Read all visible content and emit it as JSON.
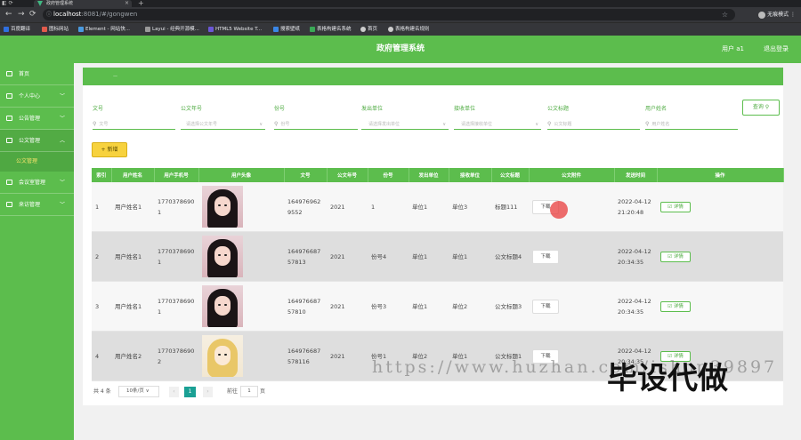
{
  "browser": {
    "tab_title": "政府管理系统",
    "url_host": "localhost",
    "url_path": ":8081/#/gongwen",
    "profile_label": "无痕模式",
    "bookmarks": [
      "百度翻译",
      "图标网站",
      "Element - 网站快...",
      "Layui - 经典开源模...",
      "HTML5 Website T...",
      "搜索壁纸",
      "表格构建名系统",
      "首页",
      "表格构建名规则"
    ]
  },
  "header": {
    "title": "政府管理系统",
    "user": "用户 a1",
    "logout": "退出登录"
  },
  "sidebar": {
    "items": [
      {
        "label": "首页",
        "has_children": false
      },
      {
        "label": "个人中心",
        "has_children": true
      },
      {
        "label": "公告管理",
        "has_children": true
      },
      {
        "label": "公文管理",
        "has_children": true,
        "open": true
      },
      {
        "label": "会议室管理",
        "has_children": true
      },
      {
        "label": "来访管理",
        "has_children": true
      }
    ],
    "submenu_label": "公文管理"
  },
  "breadcrumb": "—",
  "filters": {
    "wenhao": {
      "label": "文号",
      "placeholder": "文号"
    },
    "year": {
      "label": "公文年号",
      "placeholder": "请选择公文年号"
    },
    "fenhao": {
      "label": "份号",
      "placeholder": "份号"
    },
    "fawen": {
      "label": "发出单位",
      "placeholder": "请选择发出单位"
    },
    "jieshou": {
      "label": "接收单位",
      "placeholder": "请选择接收单位"
    },
    "biaoti": {
      "label": "公文标题",
      "placeholder": "公文标题"
    },
    "yonghu": {
      "label": "用户姓名",
      "placeholder": "用户姓名"
    },
    "query_label": "查询"
  },
  "add_label": "+ 新增",
  "table": {
    "headers": [
      "索引",
      "用户姓名",
      "用户手机号",
      "用户头像",
      "文号",
      "公文年号",
      "份号",
      "发出单位",
      "接收单位",
      "公文标题",
      "公文附件",
      "发送时间",
      "操作"
    ],
    "download_label": "下载",
    "detail_label": "☑ 详情",
    "rows": [
      {
        "index": "1",
        "name": "用户姓名1",
        "phone": "17703786901",
        "wenhao": "1649769629552",
        "year": "2021",
        "fenhao": "1",
        "from": "单位1",
        "to": "单位3",
        "title": "标题111",
        "time": "2022-04-12 21:20:48",
        "avatar": "girl"
      },
      {
        "index": "2",
        "name": "用户姓名1",
        "phone": "17703786901",
        "wenhao": "164976687 57813",
        "year": "2021",
        "fenhao": "份号4",
        "from": "单位1",
        "to": "单位1",
        "title": "公文标题4",
        "time": "2022-04-12 20:34:35",
        "avatar": "girl"
      },
      {
        "index": "3",
        "name": "用户姓名1",
        "phone": "17703786901",
        "wenhao": "164976687 57810",
        "year": "2021",
        "fenhao": "份号3",
        "from": "单位1",
        "to": "单位2",
        "title": "公文标题3",
        "time": "2022-04-12 20:34:35",
        "avatar": "girl"
      },
      {
        "index": "4",
        "name": "用户姓名2",
        "phone": "17703786902",
        "wenhao": "164976687 578116",
        "year": "2021",
        "fenhao": "份号1",
        "from": "单位2",
        "to": "单位1",
        "title": "公文标题1",
        "time": "2022-04-12 20:34:35",
        "avatar": "anime"
      }
    ]
  },
  "pagination": {
    "total": "共 4 条",
    "page_size": "10条/页",
    "current_page": "1",
    "goto_label": "前往",
    "goto_value": "1",
    "page_suffix": "页"
  },
  "watermark": {
    "url": "https://www.huzhan.com/ishop39897",
    "text": "毕设代做"
  },
  "colors": {
    "primary": "#5cbd4d",
    "accent": "#f7d23e",
    "pager": "#1aa094"
  }
}
